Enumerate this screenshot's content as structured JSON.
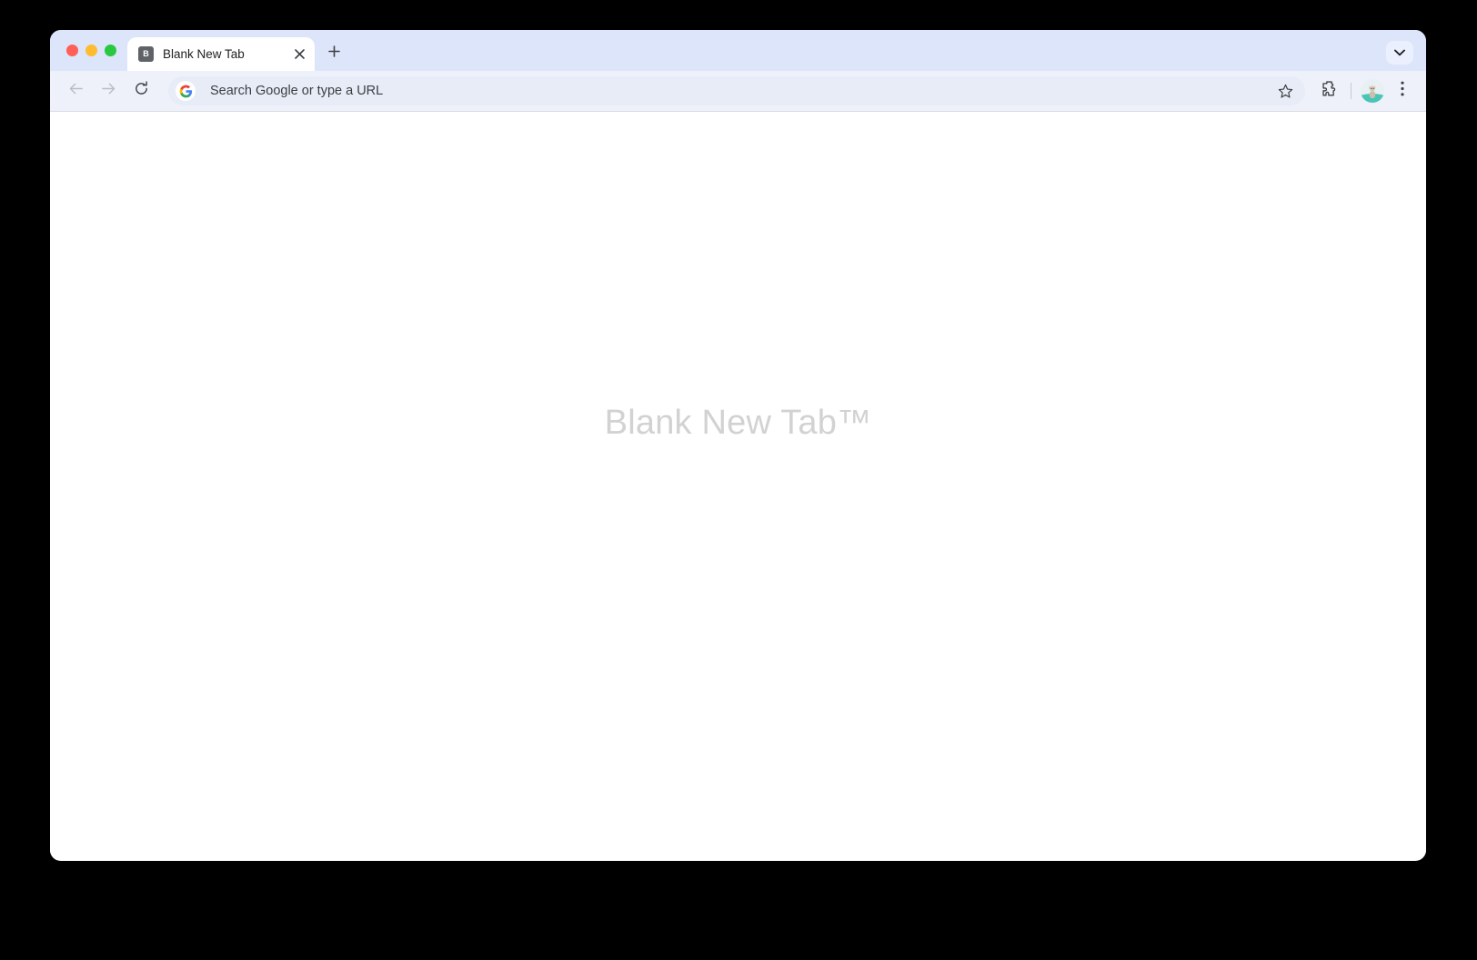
{
  "window": {
    "traffic_lights": [
      {
        "name": "close",
        "color": "#ff5f57"
      },
      {
        "name": "minimize",
        "color": "#febc2e"
      },
      {
        "name": "maximize",
        "color": "#28c840"
      }
    ],
    "tabstrip_bg": "#dce5fa",
    "toolbar_bg": "#eef1fa"
  },
  "tabstrip": {
    "tabs": [
      {
        "title": "Blank New Tab",
        "favicon_letter": "B",
        "favicon_bg": "#5f6368",
        "active": true
      }
    ],
    "close_icon": "close-icon",
    "new_tab_label": "+",
    "new_tab_icon": "plus-icon",
    "tab_search_icon": "chevron-down-icon"
  },
  "toolbar": {
    "back_icon": "arrow-left-icon",
    "forward_icon": "arrow-right-icon",
    "reload_icon": "reload-icon",
    "search_engine_icon": "google-g-icon",
    "omnibox": {
      "value": "",
      "placeholder": "Search Google or type a URL"
    },
    "bookmark_icon": "star-icon",
    "extensions_icon": "puzzle-piece-icon",
    "profile_icon": "avatar-cat-icon",
    "menu_icon": "three-dots-vertical-icon"
  },
  "page": {
    "heading": "Blank New Tab™",
    "heading_color": "#d2d2d2",
    "background": "#ffffff"
  }
}
